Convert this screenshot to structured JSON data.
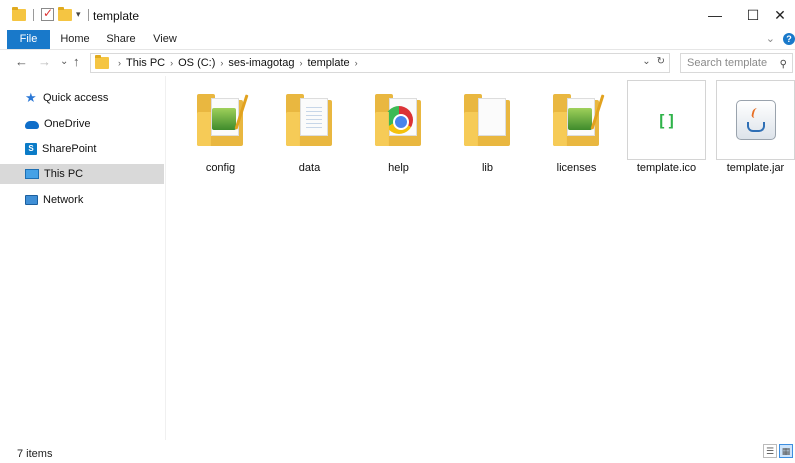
{
  "window": {
    "title": "template",
    "minimize_icon": "—",
    "maximize_icon": "☐",
    "close_icon": "✕"
  },
  "ribbon": {
    "tabs": [
      "File",
      "Home",
      "Share",
      "View"
    ],
    "expand_icon": "⌄",
    "help_icon": "?"
  },
  "address": {
    "back_icon": "←",
    "forward_icon": "→",
    "recent_icon": "⌄",
    "up_icon": "↑",
    "crumbs": [
      "This PC",
      "OS (C:)",
      "ses-imagotag",
      "template"
    ],
    "chevron": "›",
    "dropdown_icon": "⌄",
    "refresh_icon": "↻"
  },
  "search": {
    "placeholder": "Search template",
    "icon": "⚲"
  },
  "nav": {
    "items": [
      {
        "label": "Quick access",
        "icon": "star-icon"
      },
      {
        "label": "OneDrive",
        "icon": "cloud-icon"
      },
      {
        "label": "SharePoint",
        "icon": "sharepoint-icon"
      },
      {
        "label": "This PC",
        "icon": "computer-icon",
        "selected": true
      },
      {
        "label": "Network",
        "icon": "network-icon"
      }
    ],
    "sharepoint_glyph": "S"
  },
  "files": [
    {
      "name": "config",
      "type": "folder"
    },
    {
      "name": "data",
      "type": "folder"
    },
    {
      "name": "help",
      "type": "folder"
    },
    {
      "name": "lib",
      "type": "folder"
    },
    {
      "name": "licenses",
      "type": "folder"
    },
    {
      "name": "template.ico",
      "type": "ico",
      "glyph": "[]"
    },
    {
      "name": "template.jar",
      "type": "jar"
    }
  ],
  "status": {
    "count_text": "7 items",
    "details_view_icon": "☰",
    "large_icons_view_icon": "▦"
  },
  "colors": {
    "accent": "#1979ca",
    "selected_nav": "#d9d9d9",
    "folder": "#f8d36e"
  }
}
